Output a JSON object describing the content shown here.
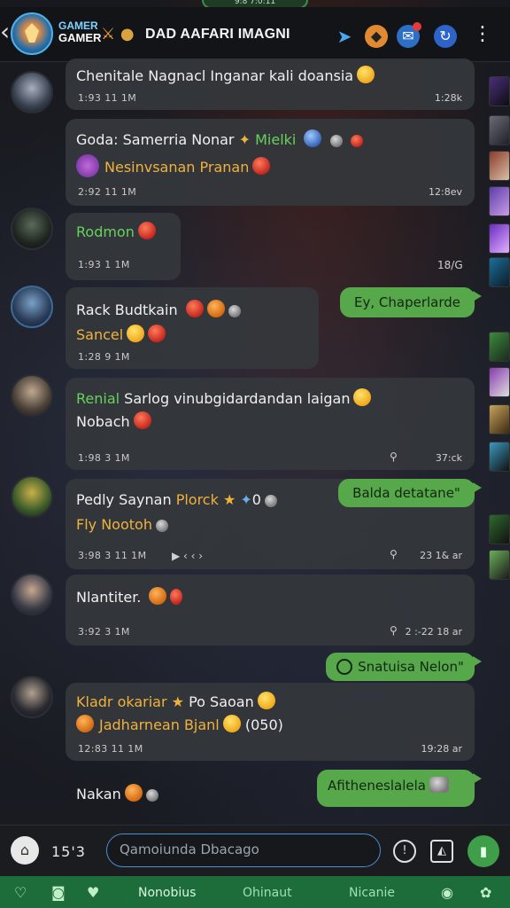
{
  "status": {
    "pill_text": "9:8 7:0:11"
  },
  "header": {
    "brand_line1": "GAMER",
    "brand_line2": "GAMER",
    "title": "DAD AAFARI IMAGNI",
    "back_icon": "chevron-left-icon",
    "icons": [
      "crossed-swords-icon",
      "helmet-icon",
      "pin-icon",
      "game-icon",
      "chat-icon",
      "sync-icon",
      "more-icon"
    ]
  },
  "messages": [
    {
      "id": "m1",
      "line1": "Chenitale Nagnacl Inganar kali doansia",
      "time": "1:93 11 1M",
      "rtime": "1:28k"
    },
    {
      "id": "m2",
      "line1_a": "Goda: Samerria Nonar",
      "line1_b": "Mielki",
      "line2": "Nesinvsanan Pranan",
      "time": "2:92 11 1M",
      "rtime": "12:8ev"
    },
    {
      "id": "m3",
      "line1": "Rodmon",
      "time": "1:93 1 1M",
      "rtime": "18/G"
    },
    {
      "id": "m4",
      "line1": "Rack Budtkain",
      "line2": "Sancel",
      "time": "1:28 9 1M",
      "reply": "Ey, Chaperlarde"
    },
    {
      "id": "m5",
      "line1_a": "Renial",
      "line1_b": "Sarlog vinubgidardandan laigan",
      "line2": "Nobach",
      "time": "1:98 3 1M",
      "rtime": "37:ck"
    },
    {
      "id": "m6",
      "line1_a": "Pedly Saynan",
      "line1_b": "Plorck",
      "line1_c": "0",
      "line2": "Fly Nootoh",
      "time": "3:98 3 11 1M",
      "rtime": "23 1& ar",
      "reply": "Balda detatane\""
    },
    {
      "id": "m7",
      "line1": "Nlantiter.",
      "time": "3:92 3 1M",
      "rtime": "2 :-22 18 ar"
    },
    {
      "id": "m8",
      "line1_a": "Kladr okariar",
      "line1_b": "Po Saoan",
      "line2_a": "Jadharnean Bjanl",
      "line2_b": "(050)",
      "time": "12:83 11 1M",
      "rtime": "19:28 ar",
      "reply": "Snatuisa Nelon\""
    },
    {
      "id": "m9",
      "line1": "Nakan",
      "reply": "Afitheneslalela"
    }
  ],
  "input": {
    "count": "15'3",
    "placeholder": "Qamoiunda Dbacago"
  },
  "nav": {
    "items": [
      "Nonobius",
      "Ohinaut",
      "Nicanie"
    ]
  },
  "colors": {
    "accent_green": "#56a84a",
    "nav_green": "#1d6d3b",
    "bubble": "#34373c",
    "name_green": "#66d35a",
    "name_gold": "#f0b23c"
  }
}
